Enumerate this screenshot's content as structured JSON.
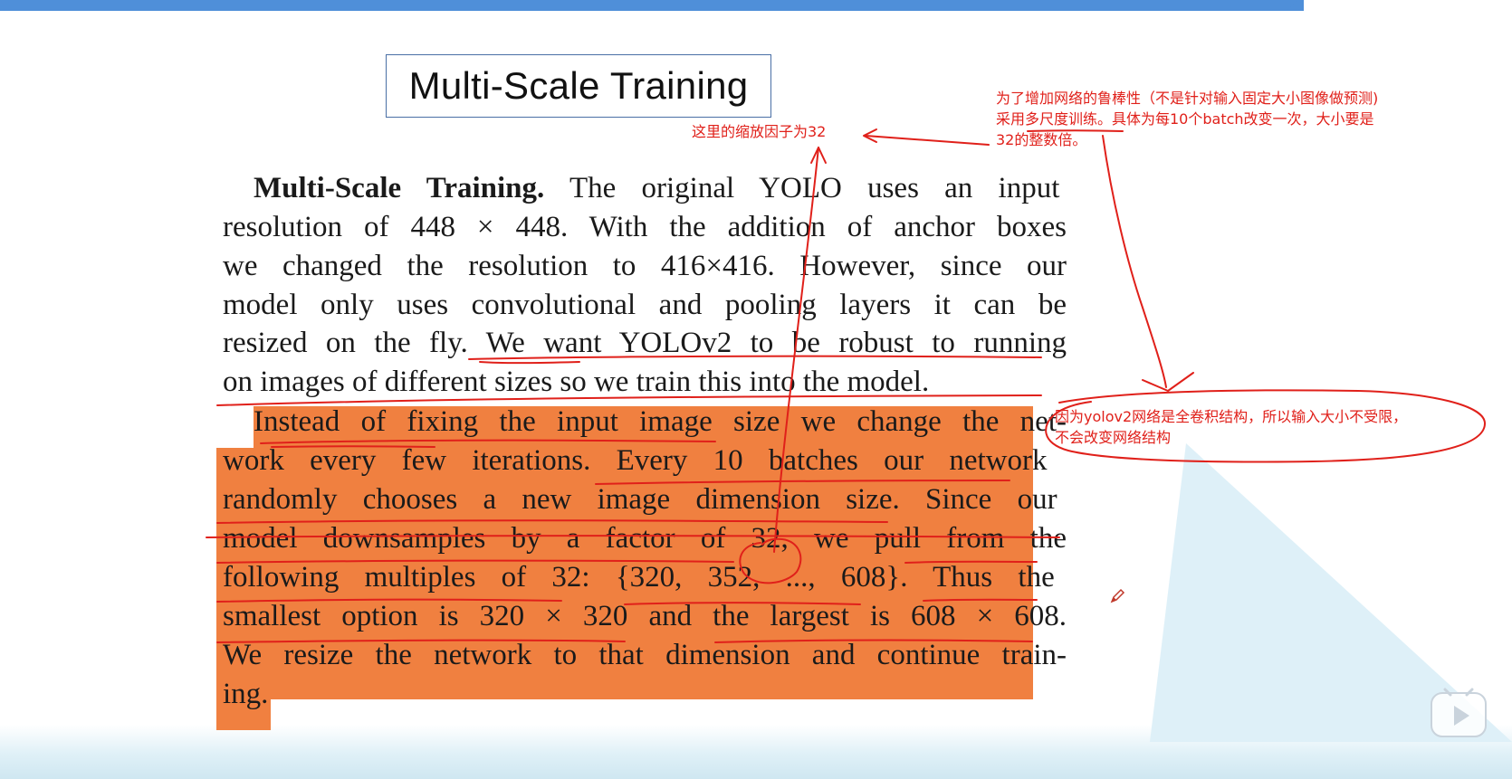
{
  "slide": {
    "title": "Multi-Scale Training"
  },
  "paper": {
    "lines": [
      {
        "bold": "Multi-Scale Training.",
        "text": " The original YOLO uses an input"
      },
      {
        "bold": "",
        "text": "resolution of 448 × 448. With the addition of anchor boxes"
      },
      {
        "bold": "",
        "text": "we changed the resolution to 416×416. However, since our"
      },
      {
        "bold": "",
        "text": "model only uses convolutional and pooling layers it can be"
      },
      {
        "bold": "",
        "text": "resized on the fly. We want YOLOv2 to be robust to running"
      },
      {
        "bold": "",
        "text": "on images of different sizes so we train this into the model."
      },
      {
        "bold": "",
        "text": "Instead of fixing the input image size we change the net-"
      },
      {
        "bold": "",
        "text": "work every few iterations. Every 10 batches our network"
      },
      {
        "bold": "",
        "text": "randomly chooses a new image dimension size. Since our"
      },
      {
        "bold": "",
        "text": "model downsamples by a factor of 32, we pull from the"
      },
      {
        "bold": "",
        "text": "following multiples of 32: {320, 352, ..., 608}. Thus the"
      },
      {
        "bold": "",
        "text": "smallest option is 320 × 320 and the largest is 608 × 608."
      },
      {
        "bold": "",
        "text": "We resize the network to that dimension and continue train-"
      },
      {
        "bold": "",
        "text": "ing."
      }
    ]
  },
  "annotations": {
    "scale_factor_note": "这里的缩放因子为32",
    "robust_note": [
      "为了增加网络的鲁棒性（不是针对输入固定大小图像做预测)",
      "采用多尺度训练。具体为每10个batch改变一次，大小要是",
      "32的整数倍。"
    ],
    "fcn_note": [
      "因为yolov2网络是全卷积结构，所以输入大小不受限，",
      "不会改变网络结构"
    ]
  },
  "colors": {
    "highlight": "#f08040",
    "annotation": "#e0201a",
    "top_bar": "#4f8fd9"
  },
  "icons": {
    "pen": "pen-icon",
    "play": "play-button-icon"
  }
}
